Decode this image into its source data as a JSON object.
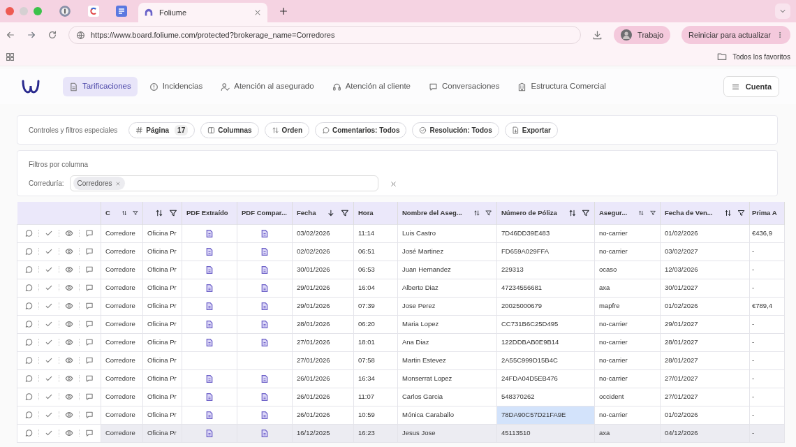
{
  "browser": {
    "active_tab": {
      "title": "Foliume"
    },
    "url": "https://www.board.foliume.com/protected?brokerage_name=Corredores",
    "profile": "Trabajo",
    "update_button": "Reiniciar para actualizar",
    "bookmarks_folder": "Todos los favoritos"
  },
  "nav": {
    "items": [
      {
        "label": "Tarificaciones",
        "selected": true
      },
      {
        "label": "Incidencias",
        "selected": false
      },
      {
        "label": "Atención al asegurado",
        "selected": false
      },
      {
        "label": "Atención al cliente",
        "selected": false
      },
      {
        "label": "Conversaciones",
        "selected": false
      },
      {
        "label": "Estructura Comercial",
        "selected": false
      }
    ],
    "account_button": "Cuenta"
  },
  "controls": {
    "label": "Controles y filtros especiales",
    "buttons": [
      {
        "label": "Página",
        "count": "17"
      },
      {
        "label": "Columnas"
      },
      {
        "label": "Orden"
      },
      {
        "label": "Comentarios: Todos"
      },
      {
        "label": "Resolución: Todos"
      },
      {
        "label": "Exportar"
      }
    ]
  },
  "filters": {
    "title": "Filtros por columna",
    "fields": [
      {
        "label": "Correduría:",
        "chips": [
          "Corredores"
        ]
      }
    ]
  },
  "table": {
    "columns": [
      {
        "kind": "text",
        "label": "C",
        "sortable": true,
        "sorted": false,
        "filter": true
      },
      {
        "kind": "text",
        "sortable": true,
        "sorted": false,
        "filter": true
      },
      {
        "kind": "pdf",
        "label": "PDF Extraído",
        "sortable": false,
        "sorted": false,
        "filter": false
      },
      {
        "kind": "pdf",
        "label": "PDF Compar...",
        "sortable": false,
        "sorted": false,
        "filter": false
      },
      {
        "kind": "text",
        "label": "Fecha",
        "sortable": true,
        "sorted": true,
        "filter": true
      },
      {
        "kind": "text",
        "label": "Hora",
        "sortable": false,
        "sorted": false,
        "filter": false
      },
      {
        "kind": "text",
        "label": "Nombre del Aseg...",
        "sortable": true,
        "sorted": false,
        "filter": true
      },
      {
        "kind": "text",
        "label": "Número de Póliza",
        "sortable": true,
        "sorted": false,
        "filter": true
      },
      {
        "kind": "text",
        "label": "Asegur...",
        "sortable": true,
        "sorted": false,
        "filter": true
      },
      {
        "kind": "text",
        "label": "Fecha de Ven...",
        "sortable": true,
        "sorted": false,
        "filter": true
      },
      {
        "kind": "text",
        "label": "Prima A",
        "sortable": false,
        "sorted": false,
        "filter": false
      }
    ],
    "rows": [
      {
        "hovered": false,
        "policy_selected": false,
        "cells": [
          "Corredore",
          "Oficina Pr",
          true,
          true,
          "03/02/2026",
          "11:14",
          "Luis Castro",
          "7D46DD39E483",
          "no-carrier",
          "01/02/2026",
          "€436,9"
        ]
      },
      {
        "hovered": false,
        "policy_selected": false,
        "cells": [
          "Corredore",
          "Oficina Pr",
          true,
          true,
          "02/02/2026",
          "06:51",
          "José Martinez",
          "FD659A029FFA",
          "no-carrier",
          "03/02/2027",
          "-"
        ]
      },
      {
        "hovered": false,
        "policy_selected": false,
        "cells": [
          "Corredore",
          "Oficina Pr",
          true,
          true,
          "30/01/2026",
          "06:53",
          "Juan Hernandez",
          "229313",
          "ocaso",
          "12/03/2026",
          "-"
        ]
      },
      {
        "hovered": false,
        "policy_selected": false,
        "cells": [
          "Corredore",
          "Oficina Pr",
          true,
          true,
          "29/01/2026",
          "16:04",
          "Alberto Diaz",
          "47234556681",
          "axa",
          "30/01/2027",
          "-"
        ]
      },
      {
        "hovered": false,
        "policy_selected": false,
        "cells": [
          "Corredore",
          "Oficina Pr",
          true,
          true,
          "29/01/2026",
          "07:39",
          "Jose Perez",
          "20025000679",
          "mapfre",
          "01/02/2026",
          "€789,4"
        ]
      },
      {
        "hovered": false,
        "policy_selected": false,
        "cells": [
          "Corredore",
          "Oficina Pr",
          true,
          true,
          "28/01/2026",
          "06:20",
          "Maria Lopez",
          "CC731B6C25D495",
          "no-carrier",
          "29/01/2027",
          "-"
        ]
      },
      {
        "hovered": false,
        "policy_selected": false,
        "cells": [
          "Corredore",
          "Oficina Pr",
          true,
          true,
          "27/01/2026",
          "18:01",
          "Ana Diaz",
          "122DDBAB0E9B14",
          "no-carrier",
          "28/01/2027",
          "-"
        ]
      },
      {
        "hovered": false,
        "policy_selected": false,
        "cells": [
          "Corredore",
          "Oficina Pr",
          false,
          false,
          "27/01/2026",
          "07:58",
          "Martin Estevez",
          "2A55C999D15B4C",
          "no-carrier",
          "28/01/2027",
          "-"
        ]
      },
      {
        "hovered": false,
        "policy_selected": false,
        "cells": [
          "Corredore",
          "Oficina Pr",
          true,
          true,
          "26/01/2026",
          "16:34",
          "Monserrat Lopez",
          "24FDA04D5EB476",
          "no-carrier",
          "27/01/2027",
          "-"
        ]
      },
      {
        "hovered": false,
        "policy_selected": false,
        "cells": [
          "Corredore",
          "Oficina Pr",
          true,
          true,
          "26/01/2026",
          "11:07",
          "Carlos Garcia",
          "548370262",
          "occident",
          "27/01/2027",
          "-"
        ]
      },
      {
        "hovered": false,
        "policy_selected": true,
        "cells": [
          "Corredore",
          "Oficina Pr",
          true,
          true,
          "26/01/2026",
          "10:59",
          "Mónica Caraballo",
          "78DA90C57D21FA9E",
          "no-carrier",
          "01/02/2026",
          "-"
        ]
      },
      {
        "hovered": true,
        "policy_selected": false,
        "cells": [
          "Corredore",
          "Oficina Pr",
          true,
          true,
          "16/12/2025",
          "16:23",
          "Jesus Jose",
          "45113510",
          "axa",
          "04/12/2026",
          "-"
        ]
      }
    ]
  }
}
